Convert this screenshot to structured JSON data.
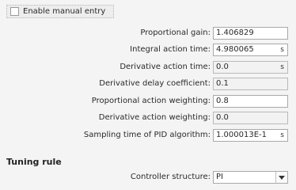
{
  "manual_entry": {
    "label": "Enable manual entry",
    "checked": false
  },
  "params": [
    {
      "label": "Proportional gain:",
      "value": "1.406829",
      "unit": "",
      "readonly": false
    },
    {
      "label": "Integral action time:",
      "value": "4.980065",
      "unit": "s",
      "readonly": false
    },
    {
      "label": "Derivative action time:",
      "value": "0.0",
      "unit": "s",
      "readonly": true
    },
    {
      "label": "Derivative delay coefficient:",
      "value": "0.1",
      "unit": "",
      "readonly": true
    },
    {
      "label": "Proportional action weighting:",
      "value": "0.8",
      "unit": "",
      "readonly": false
    },
    {
      "label": "Derivative action weighting:",
      "value": "0.0",
      "unit": "",
      "readonly": true
    },
    {
      "label": "Sampling time of PID algorithm:",
      "value": "1.000013E-1",
      "unit": "s",
      "readonly": false
    }
  ],
  "tuning_rule": {
    "heading": "Tuning rule",
    "controller_structure_label": "Controller structure:",
    "controller_structure_value": "PI"
  }
}
